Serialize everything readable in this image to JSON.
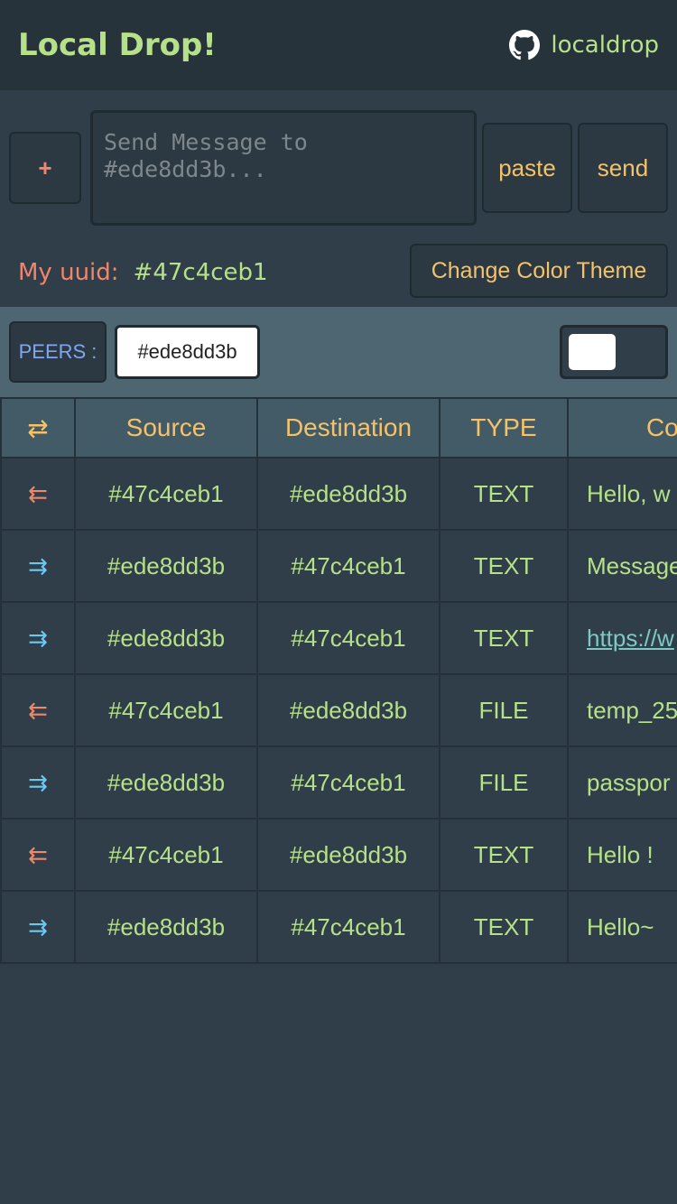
{
  "header": {
    "title": "Local Drop!",
    "repo_label": "localdrop"
  },
  "composer": {
    "add_label": "+",
    "placeholder": "Send Message to #ede8dd3b...",
    "paste_label": "paste",
    "send_label": "send",
    "uuid_label": "My uuid:",
    "uuid_value": "#47c4ceb1",
    "theme_button_label": "Change Color Theme"
  },
  "peers": {
    "label": "PEERS :",
    "items": [
      "#ede8dd3b"
    ]
  },
  "table": {
    "headers": [
      "⇄",
      "Source",
      "Destination",
      "TYPE",
      "Content"
    ],
    "rows": [
      {
        "direction": "⇇",
        "dir_class": "in",
        "source": "#47c4ceb1",
        "destination": "#ede8dd3b",
        "type": "TEXT",
        "content": "Hello, w",
        "is_link": false
      },
      {
        "direction": "⇉",
        "dir_class": "out",
        "source": "#ede8dd3b",
        "destination": "#47c4ceb1",
        "type": "TEXT",
        "content": "Message",
        "is_link": false
      },
      {
        "direction": "⇉",
        "dir_class": "out",
        "source": "#ede8dd3b",
        "destination": "#47c4ceb1",
        "type": "TEXT",
        "content": "https://w",
        "is_link": true
      },
      {
        "direction": "⇇",
        "dir_class": "in",
        "source": "#47c4ceb1",
        "destination": "#ede8dd3b",
        "type": "FILE",
        "content": "temp_25",
        "is_link": false
      },
      {
        "direction": "⇉",
        "dir_class": "out",
        "source": "#ede8dd3b",
        "destination": "#47c4ceb1",
        "type": "FILE",
        "content": "passpor",
        "is_link": false
      },
      {
        "direction": "⇇",
        "dir_class": "in",
        "source": "#47c4ceb1",
        "destination": "#ede8dd3b",
        "type": "TEXT",
        "content": "Hello !",
        "is_link": false
      },
      {
        "direction": "⇉",
        "dir_class": "out",
        "source": "#ede8dd3b",
        "destination": "#47c4ceb1",
        "type": "TEXT",
        "content": "Hello~",
        "is_link": false
      }
    ]
  },
  "icons": {
    "repo": "github-icon",
    "direction_in": "arrow-left-double-icon",
    "direction_out": "arrow-right-double-icon",
    "direction_header": "arrows-exchange-icon"
  },
  "colors": {
    "background": "#2f3e48",
    "header_bg": "#27333b",
    "peers_bar_bg": "#4e6672",
    "accent_green": "#b7e08a",
    "accent_orange": "#f3c26b",
    "accent_red": "#f0866b",
    "accent_blue": "#6cc8ee",
    "peers_label_blue": "#7fa6f0"
  },
  "toggle": {
    "on": false
  }
}
